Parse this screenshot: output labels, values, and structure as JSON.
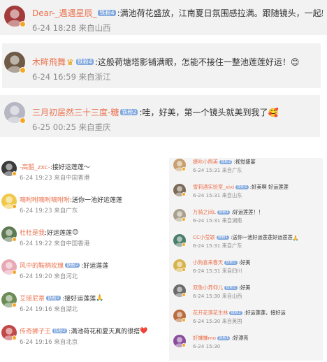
{
  "top": [
    {
      "name": "Dear-_遇遇星辰_",
      "level": "铁粉4",
      "crown": false,
      "text": ":满池荷花盛放，江南夏日氛围感拉满。跟随镜头，一起感受",
      "date": "6-24 18:28",
      "source": "来自山西",
      "av": "#a33b3b"
    },
    {
      "name": "木眸飛舞",
      "level": "铁粉4",
      "crown": true,
      "text": ":这般荷塘塔影铺满眼，怎能不接住一整池莲莲好运！",
      "emoji": "😊",
      "date": "6-24 16:59",
      "source": "来自浙江",
      "av": "#6e5a45"
    },
    {
      "name": "三月初居然三十三度-糖",
      "level": "铁粉2",
      "crown": false,
      "text": ":哇，好美，第一个镜头就美到我了",
      "emoji": "🥰",
      "date": "6-25 00:25",
      "source": "来自重庆",
      "av": "#b7b7c4"
    }
  ],
  "left": [
    {
      "name": "-高韶_zxc-",
      "level": "",
      "text": ":接好运莲莲～",
      "date": "6-24 19:23",
      "source": "来自中国香港",
      "av": "#3b3b3b"
    },
    {
      "name": "嘀咐咐嘀咐嘀咐咐",
      "level": "",
      "text": ":送你一池好运莲莲",
      "date": "6-24 19:23",
      "source": "来自广东",
      "av": "#f0c94a"
    },
    {
      "name": "杜杜是我",
      "level": "",
      "text": ":好运莲莲",
      "emoji": "😊",
      "date": "6-24 19:22",
      "source": "来自中国香港",
      "av": "#5d7a52"
    },
    {
      "name": "风中的鞍柄玫瑰",
      "level": "铁粉2",
      "text": ":好运莲莲",
      "date": "6-24 19:20",
      "source": "来自河北",
      "av": "#e7a9b4"
    },
    {
      "name": "艾瑶尼蒂",
      "level": "铁粉1",
      "text": ":接好运莲莲",
      "emoji": "🙏",
      "date": "6-24 19:16",
      "source": "来自湖北",
      "av": "#6b8c55"
    },
    {
      "name": "传奇狮子王",
      "level": "铁粉2",
      "text": ":满池荷花和夏天真的很搭",
      "emoji": "❤️",
      "date": "6-24 19:16",
      "source": "来自北京",
      "av": "#c24848"
    }
  ],
  "right": [
    {
      "name": "婕咔小熊美",
      "level": "铁粉2",
      "text": ":视觉盛宴",
      "date": "6-24 15:31",
      "source": "来自广东",
      "av": "#c6a070"
    },
    {
      "name": "雪莉酒实验室_xixi",
      "level": "铁粉1",
      "text": ":好美啊 好运莲莲",
      "date": "6-24 15:31",
      "source": "来自山东",
      "av": "#7a6a58"
    },
    {
      "name": "万骑之间L",
      "level": "铁粉1",
      "text": ":好运莲莲！！",
      "date": "6-24 15:31",
      "source": "来自湖南",
      "av": "#a8a08a"
    },
    {
      "name": "CC小莹颖",
      "level": "铁粉1",
      "text": ":送你一池好运莲莲",
      "text2": "好运莲莲",
      "emoji": "🙏",
      "date": "6-24 15:31",
      "source": "来自广东",
      "av": "#4a7d6a"
    },
    {
      "name": "小狗喜来春天",
      "level": "铁粉2",
      "text": ":好美",
      "date": "6-24 15:31",
      "source": "来自四川",
      "av": "#d7b34d"
    },
    {
      "name": "双鱼小养仰儿",
      "level": "铁粉1",
      "text": ":好美",
      "date": "6-24 15:30",
      "source": "来自山西",
      "av": "#6a6a6a"
    },
    {
      "name": "花开花落花生林",
      "level": "铁粉2",
      "text": ":好运莲莲，接好运",
      "date": "6-24 15:30",
      "source": "来自英国",
      "av": "#b96c3e"
    },
    {
      "name": "好嫌嫌mo",
      "level": "铁粉1",
      "text": ":好漂亮",
      "date": "6-24 15:30",
      "source": "",
      "av": "#8a4f9c"
    }
  ]
}
